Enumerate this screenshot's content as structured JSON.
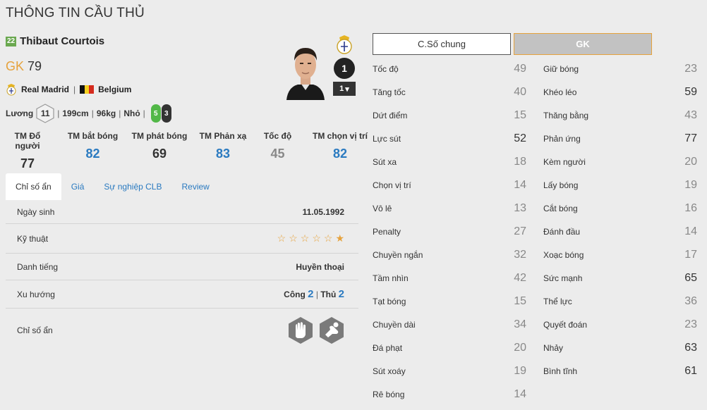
{
  "title": "THÔNG TIN CẦU THỦ",
  "player": {
    "season_badge": "22",
    "name": "Thibaut Courtois",
    "position": "GK",
    "overall": "79",
    "club": "Real Madrid",
    "nation": "Belgium",
    "salary_label": "Lương",
    "salary": "11",
    "height": "199cm",
    "weight": "96kg",
    "body_type": "Nhỏ",
    "left_foot": "5",
    "right_foot": "3",
    "enhance_level": "1",
    "enhance_select": "1"
  },
  "tm_stats": [
    {
      "label": "TM Đổ người",
      "value": "77",
      "color": "#333333"
    },
    {
      "label": "TM bắt bóng",
      "value": "82",
      "color": "#2a7ac0"
    },
    {
      "label": "TM phát bóng",
      "value": "69",
      "color": "#333333"
    },
    {
      "label": "TM Phản xạ",
      "value": "83",
      "color": "#2a7ac0"
    },
    {
      "label": "Tốc độ",
      "value": "45",
      "color": "#888888"
    },
    {
      "label": "TM chọn vị trí",
      "value": "82",
      "color": "#2a7ac0"
    }
  ],
  "tabs": [
    "Chỉ số ẩn",
    "Giá",
    "Sự nghiệp CLB",
    "Review"
  ],
  "info": {
    "birthday_label": "Ngày sinh",
    "birthday": "11.05.1992",
    "skill_label": "Kỹ thuật",
    "skill_stars": 1,
    "skill_max": 6,
    "rep_label": "Danh tiếng",
    "rep": "Huyền thoại",
    "trend_label": "Xu hướng",
    "attack_label": "Công",
    "attack": "2",
    "defense_label": "Thủ",
    "defense": "2",
    "hidden_label": "Chỉ số ẩn",
    "hidden_icons": [
      "goalkeeper-glove-icon",
      "long-throw-icon"
    ]
  },
  "buttons": {
    "general": "C.Số chung",
    "gk": "GK"
  },
  "attributes_left": [
    {
      "name": "Tốc độ",
      "value": "49"
    },
    {
      "name": "Tăng tốc",
      "value": "40"
    },
    {
      "name": "Dứt điểm",
      "value": "15"
    },
    {
      "name": "Lực sút",
      "value": "52"
    },
    {
      "name": "Sút xa",
      "value": "18"
    },
    {
      "name": "Chọn vị trí",
      "value": "14"
    },
    {
      "name": "Vô lê",
      "value": "13"
    },
    {
      "name": "Penalty",
      "value": "27"
    },
    {
      "name": "Chuyền ngắn",
      "value": "32"
    },
    {
      "name": "Tầm nhìn",
      "value": "42"
    },
    {
      "name": "Tạt bóng",
      "value": "15"
    },
    {
      "name": "Chuyền dài",
      "value": "34"
    },
    {
      "name": "Đá phạt",
      "value": "20"
    },
    {
      "name": "Sút xoáy",
      "value": "19"
    },
    {
      "name": "Rê bóng",
      "value": "14"
    }
  ],
  "attributes_right": [
    {
      "name": "Giữ bóng",
      "value": "23"
    },
    {
      "name": "Khéo léo",
      "value": "59"
    },
    {
      "name": "Thăng bằng",
      "value": "43"
    },
    {
      "name": "Phản ứng",
      "value": "77"
    },
    {
      "name": "Kèm người",
      "value": "20"
    },
    {
      "name": "Lấy bóng",
      "value": "19"
    },
    {
      "name": "Cắt bóng",
      "value": "16"
    },
    {
      "name": "Đánh đầu",
      "value": "14"
    },
    {
      "name": "Xoạc bóng",
      "value": "17"
    },
    {
      "name": "Sức mạnh",
      "value": "65"
    },
    {
      "name": "Thể lực",
      "value": "36"
    },
    {
      "name": "Quyết đoán",
      "value": "23"
    },
    {
      "name": "Nhảy",
      "value": "63"
    },
    {
      "name": "Bình tĩnh",
      "value": "61"
    }
  ],
  "colors": {
    "accent": "#2a7ac0",
    "gold": "#e6a23c",
    "left_foot": "#52b848",
    "right_foot": "#333333"
  }
}
